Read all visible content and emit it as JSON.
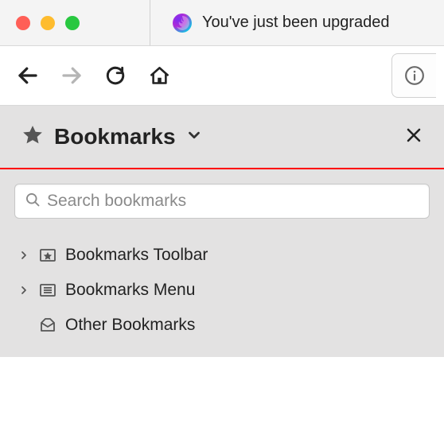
{
  "window": {
    "tab_title": "You've just been upgraded"
  },
  "sidebar": {
    "title": "Bookmarks",
    "search_placeholder": "Search bookmarks",
    "items": [
      {
        "label": "Bookmarks Toolbar"
      },
      {
        "label": "Bookmarks Menu"
      },
      {
        "label": "Other Bookmarks"
      }
    ]
  }
}
